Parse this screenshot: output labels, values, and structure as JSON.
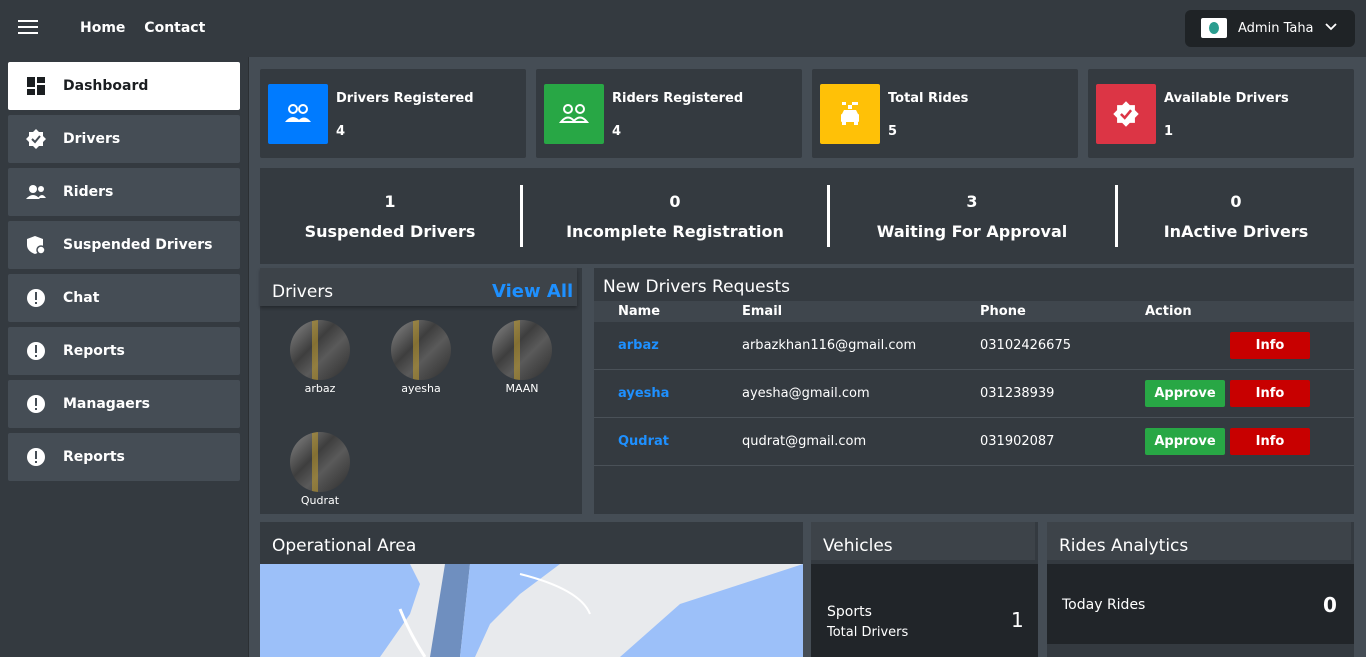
{
  "topbar": {
    "nav": [
      "Home",
      "Contact"
    ],
    "admin_name": "Admin Taha"
  },
  "sidebar": {
    "items": [
      {
        "label": "Dashboard",
        "icon": "dashboard-icon",
        "active": true
      },
      {
        "label": "Drivers",
        "icon": "verified-badge-icon"
      },
      {
        "label": "Riders",
        "icon": "users-icon"
      },
      {
        "label": "Suspended Drivers",
        "icon": "shield-icon"
      },
      {
        "label": "Chat",
        "icon": "alert-circle-icon"
      },
      {
        "label": "Reports",
        "icon": "alert-circle-icon"
      },
      {
        "label": "Managaers",
        "icon": "alert-circle-icon"
      },
      {
        "label": "Reports",
        "icon": "alert-circle-icon"
      }
    ]
  },
  "info_boxes": [
    {
      "title": "Drivers Registered",
      "value": "4",
      "color": "#007bff",
      "icon": "users-icon"
    },
    {
      "title": "Riders Registered",
      "value": "4",
      "color": "#28a745",
      "icon": "user-group-icon"
    },
    {
      "title": "Total Rides",
      "value": "5",
      "color": "#ffc107",
      "icon": "car-icon"
    },
    {
      "title": "Available Drivers",
      "value": "1",
      "color": "#dc3545",
      "icon": "verified-badge-icon"
    }
  ],
  "stats": [
    {
      "value": "1",
      "label": "Suspended Drivers"
    },
    {
      "value": "0",
      "label": "Incomplete Registration"
    },
    {
      "value": "3",
      "label": "Waiting For Approval"
    },
    {
      "value": "0",
      "label": "InActive Drivers"
    }
  ],
  "drivers": {
    "title": "Drivers",
    "view_all": "View All",
    "list": [
      "arbaz",
      "ayesha",
      "MAAN",
      "Qudrat"
    ]
  },
  "requests": {
    "title": "New Drivers Requests",
    "headers": [
      "Name",
      "Email",
      "Phone",
      "Action"
    ],
    "rows": [
      {
        "name": "arbaz",
        "email": "arbazkhan116@gmail.com",
        "phone": "03102426675",
        "approve": false
      },
      {
        "name": "ayesha",
        "email": "ayesha@gmail.com",
        "phone": "031238939",
        "approve": true
      },
      {
        "name": "Qudrat",
        "email": "qudrat@gmail.com",
        "phone": "031902087",
        "approve": true
      }
    ],
    "approve_label": "Approve",
    "info_label": "Info"
  },
  "operational": {
    "title": "Operational Area"
  },
  "vehicles": {
    "title": "Vehicles",
    "type": "Sports",
    "sub": "Total Drivers",
    "count": "1"
  },
  "rides": {
    "title": "Rides Analytics",
    "label": "Today Rides",
    "count": "0"
  }
}
